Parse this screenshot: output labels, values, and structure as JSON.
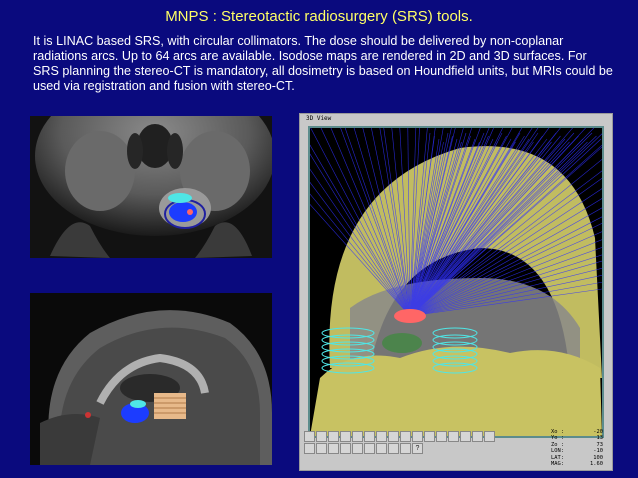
{
  "slide": {
    "title": "MNPS : Stereotactic radiosurgery (SRS) tools.",
    "description": "It is LINAC based SRS, with circular collimators. The dose should be delivered by non-coplanar radiations arcs. Up to 64 arcs are available. Isodose maps are rendered in 2D and 3D surfaces. For SRS planning the stereo-CT is mandatory, all dosimetry is based on Houndfield units, but MRIs could be used via registration and fusion with stereo-CT."
  },
  "view3d": {
    "title": "3D View"
  },
  "toolbar": {
    "icons": [
      "rotate-left-icon",
      "rotate-right-icon",
      "flip-icon",
      "pan-icon",
      "zoom-in-icon",
      "zoom-out-icon",
      "select-icon",
      "crosshair-icon",
      "arrow-icon",
      "skull-icon",
      "sphere-icon",
      "target-icon",
      "stop-icon",
      "frame-icon",
      "arrow-left-icon",
      "arrow-right-icon",
      "print-icon",
      "export-icon",
      "save-icon",
      "grid-icon",
      "record-icon",
      "shade-icon",
      "cone-icon",
      "color-icon",
      "move-icon",
      "help-icon"
    ],
    "help_glyph": "?"
  },
  "readout": {
    "rows": [
      {
        "label": "Xo  :",
        "value": "-20"
      },
      {
        "label": "Yo  :",
        "value": "13"
      },
      {
        "label": "Zo  :",
        "value": "73"
      },
      {
        "label": "LON:",
        "value": "-10"
      },
      {
        "label": "LAT:",
        "value": "100"
      },
      {
        "label": "MAG:",
        "value": "1.60"
      }
    ]
  },
  "colors": {
    "background": "#0a0a7e",
    "title": "#ffff66",
    "text": "#ffffff",
    "skull": "#d6d06a",
    "isodose_cyan": "#4fe6e6",
    "target_red": "#ff6666",
    "beam_blue": "#3030ff"
  }
}
